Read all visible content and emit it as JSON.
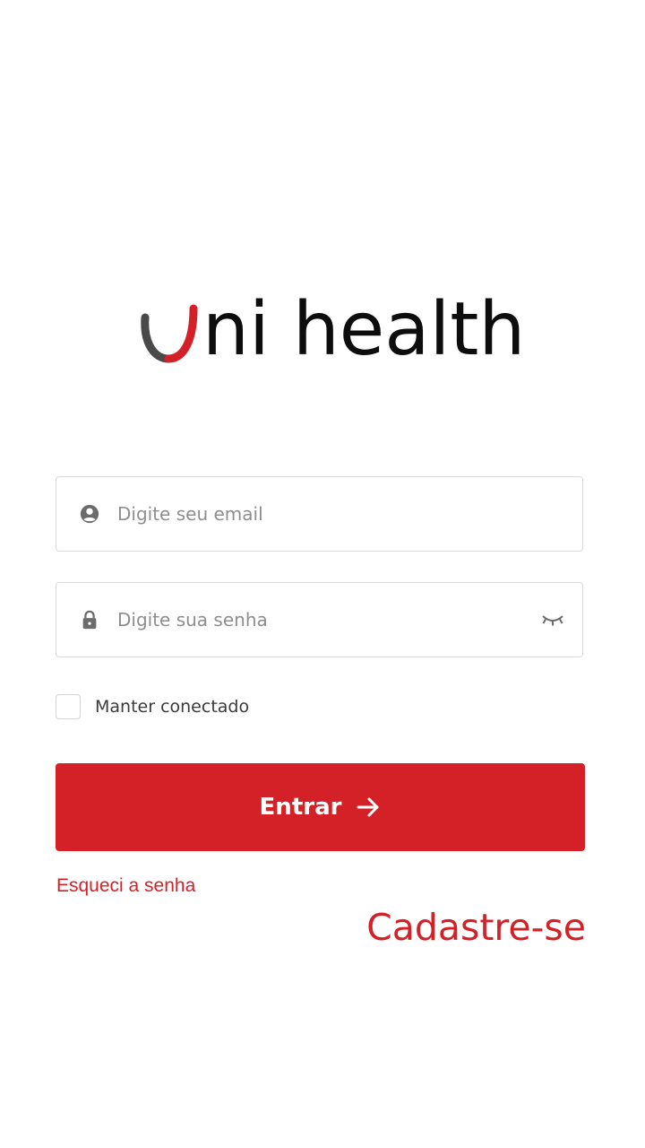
{
  "logo": {
    "text": "ni health",
    "mark_icon": "u-smile-logo-icon",
    "colors": {
      "gray": "#4a4a4a",
      "red": "#d42027"
    }
  },
  "login": {
    "email": {
      "icon": "user-circle-icon",
      "placeholder": "Digite seu email",
      "value": ""
    },
    "password": {
      "icon": "lock-icon",
      "placeholder": "Digite sua senha",
      "value": "",
      "toggle_icon": "eye-closed-icon"
    },
    "remember": {
      "label": "Manter conectado",
      "checked": false
    },
    "submit": {
      "label": "Entrar",
      "icon": "arrow-right-icon"
    },
    "forgot_link": "Esqueci a senha",
    "signup_link": "Cadastre-se"
  },
  "theme": {
    "accent": "#d42027",
    "border": "#d9d9d9",
    "placeholder": "#8e8e8e"
  }
}
